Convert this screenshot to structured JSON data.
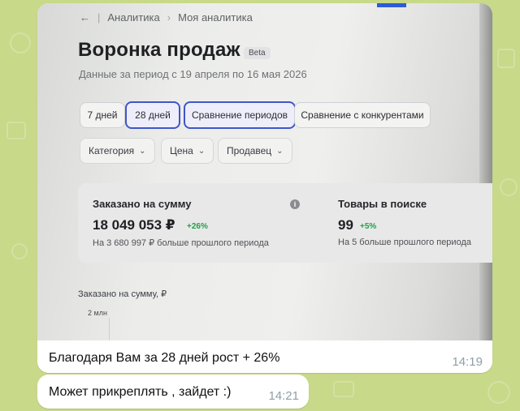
{
  "photo": {
    "breadcrumb": {
      "back_icon": "←",
      "item1": "Аналитика",
      "item2": "Моя аналитика"
    },
    "title": "Воронка продаж",
    "beta": "Beta",
    "subtitle": "Данные за период с 19 апреля по 16 мая 2026",
    "period_tabs": [
      "7 дней",
      "28 дней",
      "Сравнение периодов",
      "Сравнение с конкурентами"
    ],
    "filters": [
      "Категория",
      "Цена",
      "Продавец"
    ],
    "metrics": {
      "ordered": {
        "label": "Заказано на сумму",
        "value": "18 049 053 ₽",
        "delta": "+26%",
        "note": "На 3 680 997 ₽ больше прошлого периода"
      },
      "search": {
        "label": "Товары в поиске",
        "value": "99",
        "delta": "+5%",
        "note": "На 5 больше прошлого периода"
      }
    },
    "chart": {
      "title": "Заказано на сумму, ₽",
      "tick": "2 млн"
    }
  },
  "messages": [
    {
      "text": "Благодаря Вам за 28 дней рост + 26%",
      "time": "14:19"
    },
    {
      "text": "Может прикреплять , зайдет :)",
      "time": "14:21"
    }
  ],
  "colors": {
    "accent_blue": "#3f57c8",
    "positive_green": "#21a048",
    "time_gray": "#8fa0a8"
  }
}
